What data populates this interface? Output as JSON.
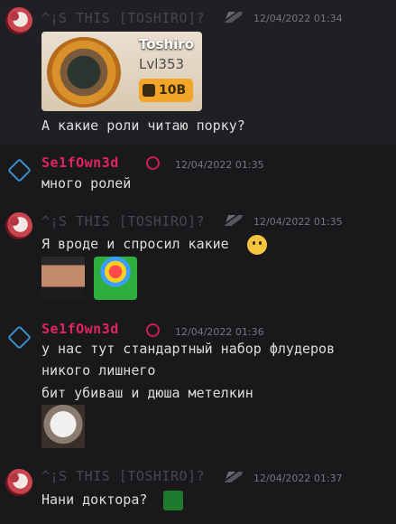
{
  "messages": [
    {
      "author": "^¡S THIS [TOSHIRO]?",
      "time": "12/04/2022 01:34",
      "card": {
        "name": "Toshiro",
        "level": "Lvl353",
        "power": "10B"
      },
      "lines": [
        "А какие роли читаю порку?"
      ]
    },
    {
      "author": "Se1fOwn3d",
      "time": "12/04/2022 01:35",
      "lines": [
        "много ролей"
      ]
    },
    {
      "author": "^¡S THIS [TOSHIRO]?",
      "time": "12/04/2022 01:35",
      "lines": [
        "Я вроде и спросил какие"
      ]
    },
    {
      "author": "Se1fOwn3d",
      "time": "12/04/2022 01:36",
      "lines": [
        "у нас тут стандартный набор флудеров",
        "никого лишнего",
        "бит убиваш и дюша метелкин"
      ]
    },
    {
      "author": "^¡S THIS [TOSHIRO]?",
      "time": "12/04/2022 01:37",
      "lines": [
        "Нани доктора?"
      ]
    }
  ],
  "colors": {
    "background": "#19191c",
    "highlight": "#202024",
    "se_name": "#e0245e",
    "user_name": "#474750"
  }
}
